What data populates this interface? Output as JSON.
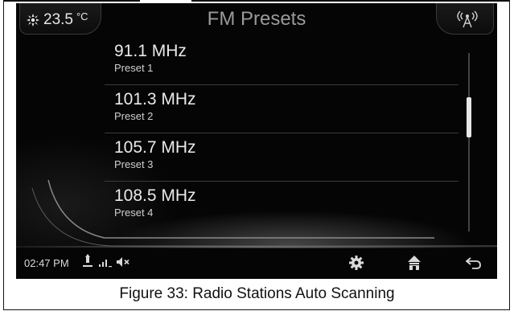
{
  "header": {
    "temperature_value": "23.5",
    "temperature_unit": "°C",
    "title": "FM Presets"
  },
  "presets": [
    {
      "frequency": "91.1 MHz",
      "label": "Preset 1"
    },
    {
      "frequency": "101.3 MHz",
      "label": "Preset 2"
    },
    {
      "frequency": "105.7 MHz",
      "label": "Preset 3"
    },
    {
      "frequency": "108.5 MHz",
      "label": "Preset 4"
    }
  ],
  "status_bar": {
    "time": "02:47 PM"
  },
  "icons": {
    "climate": "fan-icon",
    "signal_source": "antenna-icon",
    "usb": "usb-icon",
    "signal": "signal-bars-icon",
    "volume": "mute-icon",
    "settings": "gear-icon",
    "home": "home-icon",
    "back": "back-icon"
  },
  "caption": "Figure 33: Radio Stations Auto Scanning",
  "colors": {
    "screen_background": "#050505",
    "text_primary": "#e9e9e9",
    "title_gray": "#9a9a9a",
    "scroll_thumb": "#e8e8e8"
  }
}
